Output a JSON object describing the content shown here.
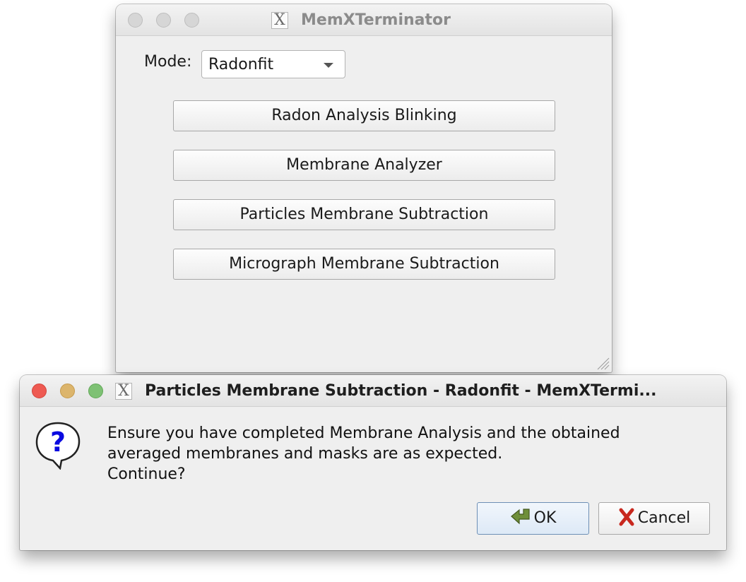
{
  "main_window": {
    "title": "MemXTerminator",
    "app_icon_glyph": "X",
    "mode_label": "Mode:",
    "mode_select": {
      "value": "Radonfit"
    },
    "buttons": [
      {
        "label": "Radon Analysis Blinking"
      },
      {
        "label": "Membrane Analyzer"
      },
      {
        "label": "Particles Membrane Subtraction"
      },
      {
        "label": "Micrograph Membrane Subtraction"
      }
    ]
  },
  "dialog": {
    "title": "Particles Membrane Subtraction - Radonfit - MemXTermi...",
    "app_icon_glyph": "X",
    "icon": "question-icon",
    "message_lines": [
      "Ensure you have completed Membrane Analysis and the obtained",
      "averaged membranes and masks are as expected.",
      "Continue?"
    ],
    "ok_label": "OK",
    "cancel_label": "Cancel"
  },
  "colors": {
    "window_bg": "#efefef",
    "traffic_red": "#ee5a52",
    "traffic_yellow": "#dcb56c",
    "traffic_green": "#7ec174",
    "question_blue": "#0a0ae0",
    "ok_border": "#6d8fb5"
  }
}
